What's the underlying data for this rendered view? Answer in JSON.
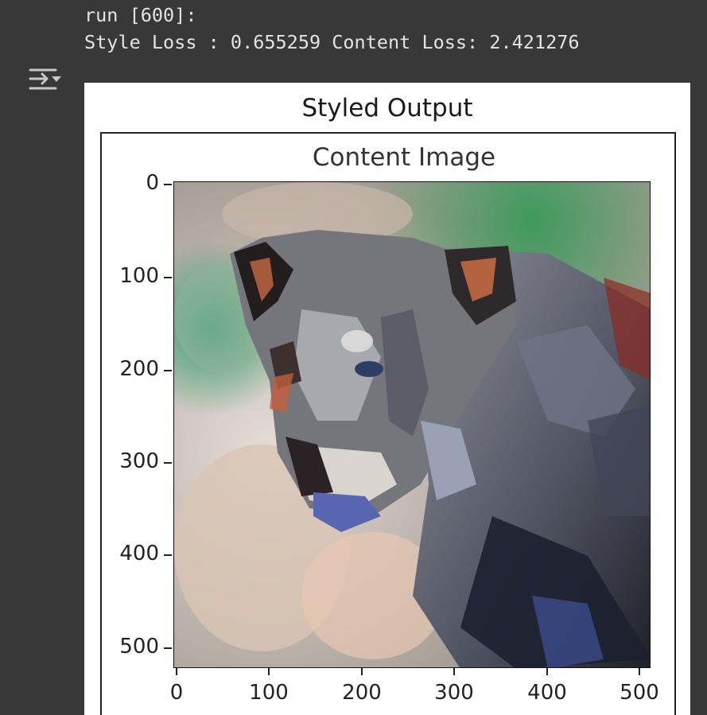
{
  "output": {
    "run_line": "run [600]:",
    "loss_line": "Style Loss : 0.655259 Content Loss: 2.421276"
  },
  "toolbar": {
    "toggle_icon": "output-collapse-icon"
  },
  "figure": {
    "suptitle": "Styled Output",
    "axes_title": "Content Image",
    "image_description": "Stylized painting of a cougar",
    "y_ticks": [
      "0",
      "100",
      "200",
      "300",
      "400",
      "500"
    ],
    "x_ticks": [
      "0",
      "100",
      "200",
      "300",
      "400",
      "500"
    ]
  },
  "colors": {
    "cell_bg": "#383838",
    "text": "#e3e3e3",
    "figure_bg": "#ffffff"
  }
}
